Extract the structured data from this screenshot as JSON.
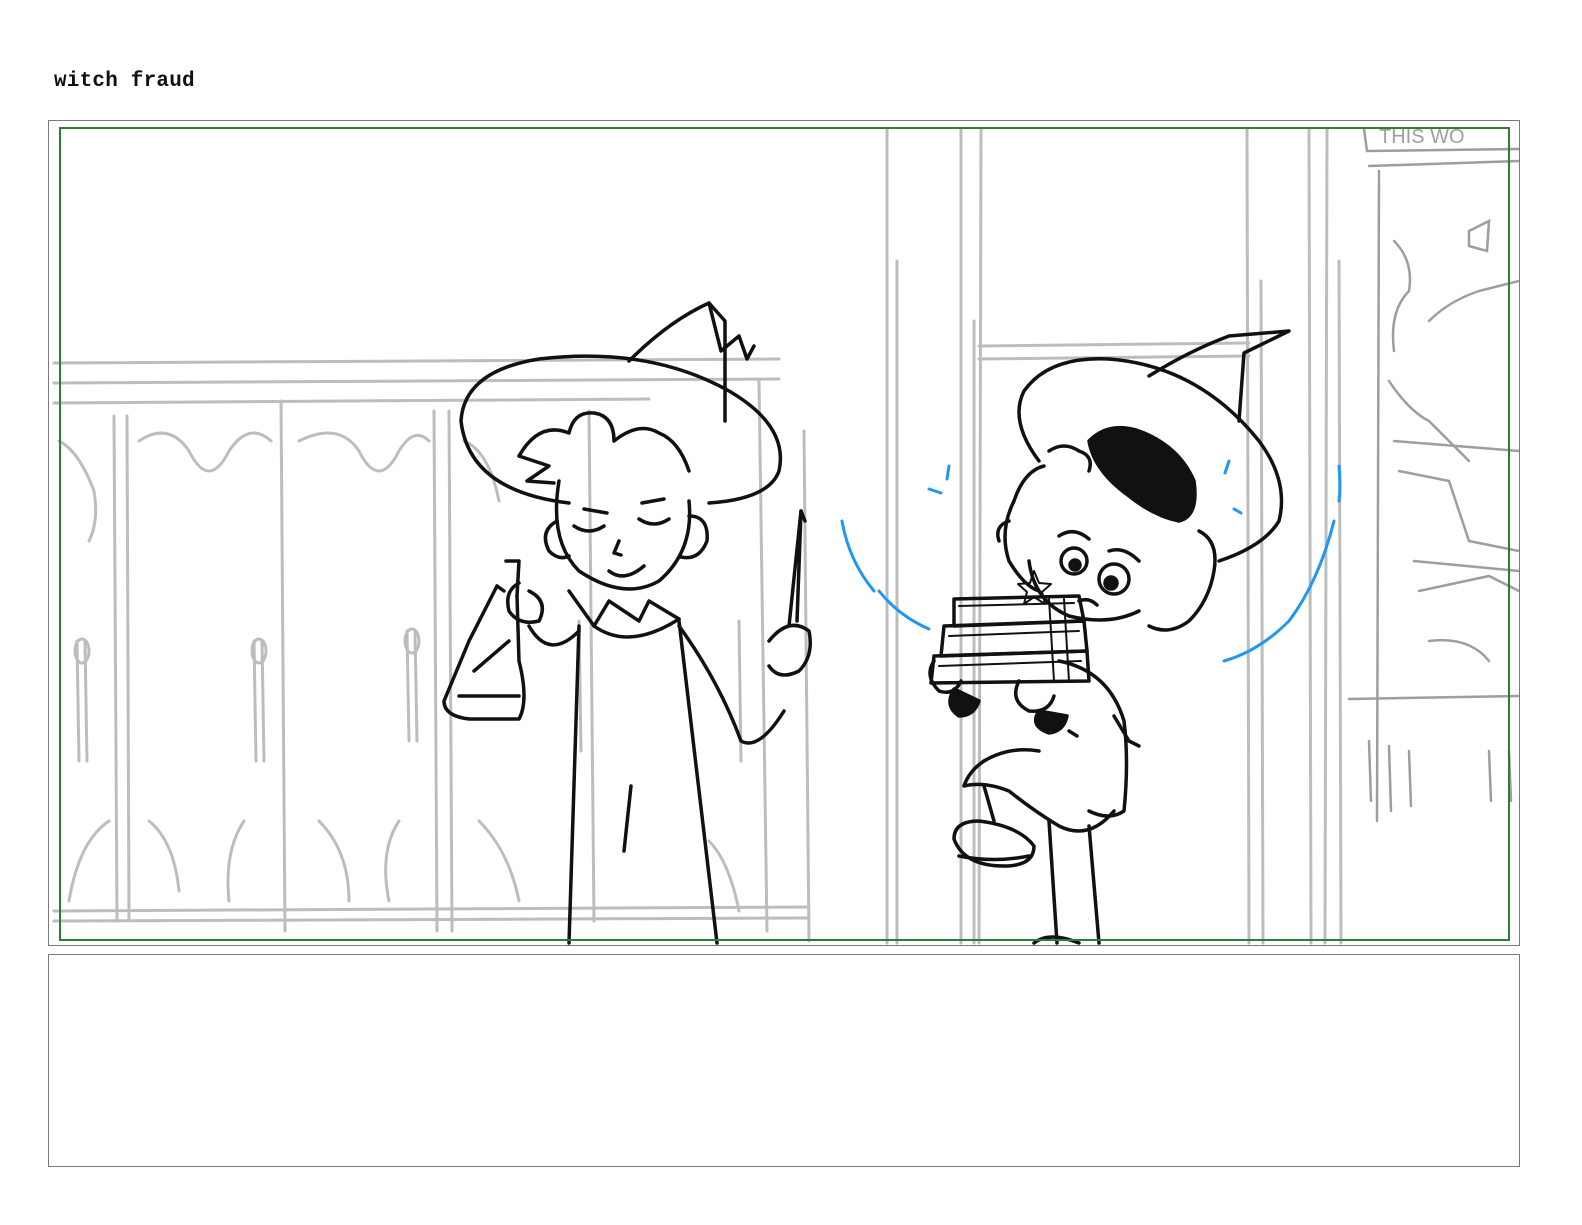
{
  "page": {
    "title": "witch fraud"
  },
  "panel": {
    "sign_text": "THIS WO",
    "colors": {
      "frame_border": "#7a7a7a",
      "safe_area_border": "#2e7d32",
      "background_sketch": "#bdbdbd",
      "ink": "#111111",
      "motion_lines": "#2196f3"
    }
  },
  "notes": {
    "text": ""
  }
}
